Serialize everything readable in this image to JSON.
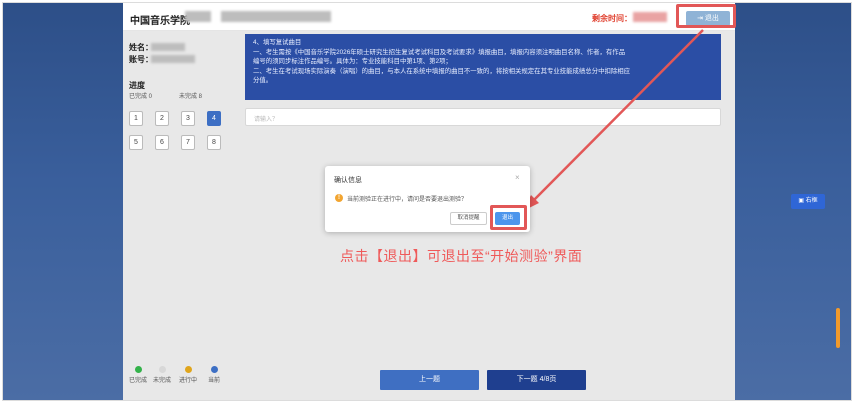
{
  "header": {
    "app_title": "中国音乐学院",
    "timer_label": "剩余时间：",
    "exit_label": "⇥ 退出"
  },
  "sidebar": {
    "name_label": "姓名：",
    "id_label": "账号：",
    "progress_title": "进度",
    "completed_text": "已完成 0",
    "incomplete_text": "未完成 8",
    "questions": [
      "1",
      "2",
      "3",
      "4",
      "5",
      "6",
      "7",
      "8"
    ],
    "current_index": 3,
    "legend": [
      {
        "label": "已完成",
        "color": "#33b24a"
      },
      {
        "label": "未完成",
        "color": "#d8d8d8"
      },
      {
        "label": "进行中",
        "color": "#e0a51c"
      },
      {
        "label": "当前",
        "color": "#3d6fc4"
      }
    ]
  },
  "question": {
    "lines": [
      "4、填写复试曲目",
      "一、考生需按《中国音乐学院2026年硕士研究生招生复试考试科目及考试要求》填报曲目，填报内容须注明曲目名称、作者，有作品",
      "编号的须同步标注作品编号。具体为：专业技能科目中第1项、第2项；",
      "二、考生在考试现场实际演奏（演唱）的曲目，与本人在系统中填报的曲目不一致的，将按相关规定在其专业技能成绩总分中扣除相应",
      "分值。"
    ],
    "input_placeholder": "请输入？"
  },
  "dialog": {
    "title": "确认信息",
    "close": "×",
    "warn_icon": "!",
    "message": "当前测验正在进行中，请问是否要退出测验？",
    "cancel_label": "取消提醒",
    "confirm_label": "退出"
  },
  "annotation": {
    "text": "点击【退出】可退出至“开始测验”界面",
    "color": "#ef5a5a"
  },
  "footer": {
    "prev_label": "上一题",
    "next_label": "下一题 4/8页"
  },
  "float_button": {
    "label": "▣ 右框"
  }
}
